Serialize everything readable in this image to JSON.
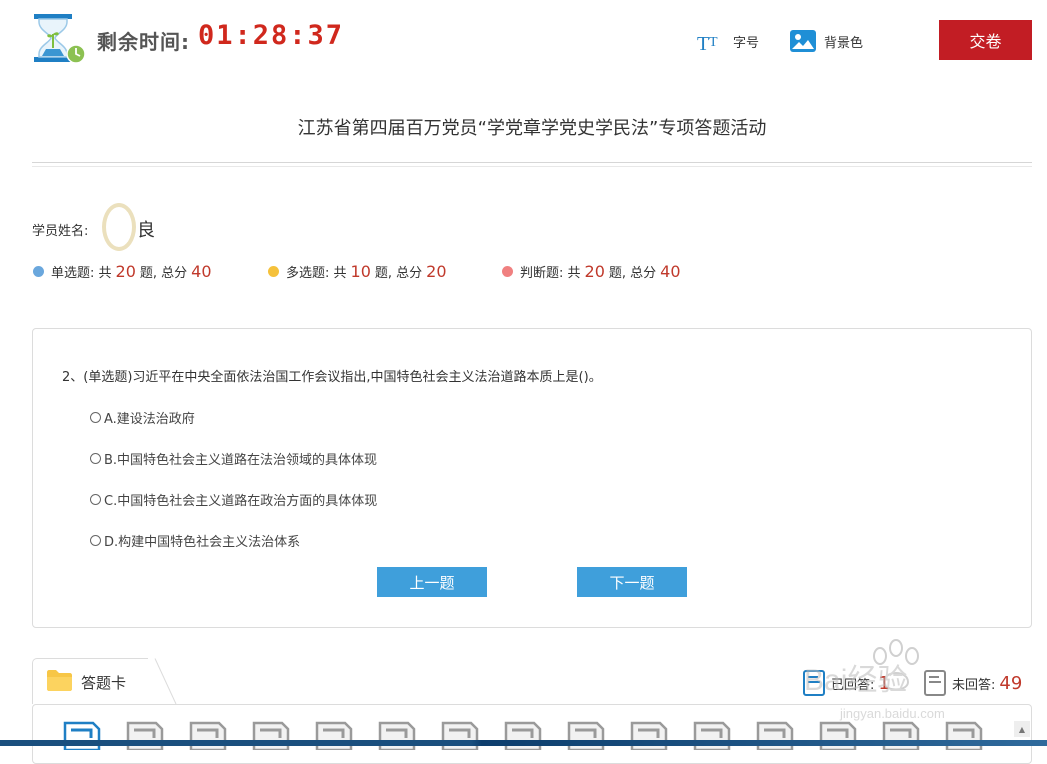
{
  "header": {
    "timer_label": "剩余时间:",
    "timer_value": "01:28:37",
    "font_size_label": "字号",
    "bg_color_label": "背景色",
    "submit_label": "交卷"
  },
  "page_title": "江苏省第四届百万党员“学党章学党史学民法”专项答题活动",
  "student": {
    "label": "学员姓名:",
    "name": "良"
  },
  "stats": [
    {
      "prefix": "单选题: 共",
      "count": "20",
      "mid": "题, 总分",
      "score": "40",
      "color": "#6aa7dd"
    },
    {
      "prefix": "多选题: 共",
      "count": "10",
      "mid": "题, 总分",
      "score": "20",
      "color": "#f5c13b"
    },
    {
      "prefix": "判断题: 共",
      "count": "20",
      "mid": "题, 总分",
      "score": "40",
      "color": "#f08080"
    }
  ],
  "question": {
    "text": "2、(单选题)习近平在中央全面依法治国工作会议指出,中国特色社会主义法治道路本质上是()。",
    "options": [
      "A.建设法治政府",
      "B.中国特色社会主义道路在法治领域的具体体现",
      "C.中国特色社会主义道路在政治方面的具体体现",
      "D.构建中国特色社会主义法治体系"
    ]
  },
  "nav": {
    "prev_label": "上一题",
    "next_label": "下一题"
  },
  "answer_card": {
    "label": "答题卡",
    "answered_label": "已回答:",
    "answered_count": "1",
    "unanswered_label": "未回答:",
    "unanswered_count": "49"
  },
  "watermark": {
    "text": "Bai经验",
    "url": "jingyan.baidu.com"
  },
  "colors": {
    "accent_red": "#c21d24",
    "timer_red": "#d0281d",
    "nav_blue": "#3f9fdb"
  }
}
